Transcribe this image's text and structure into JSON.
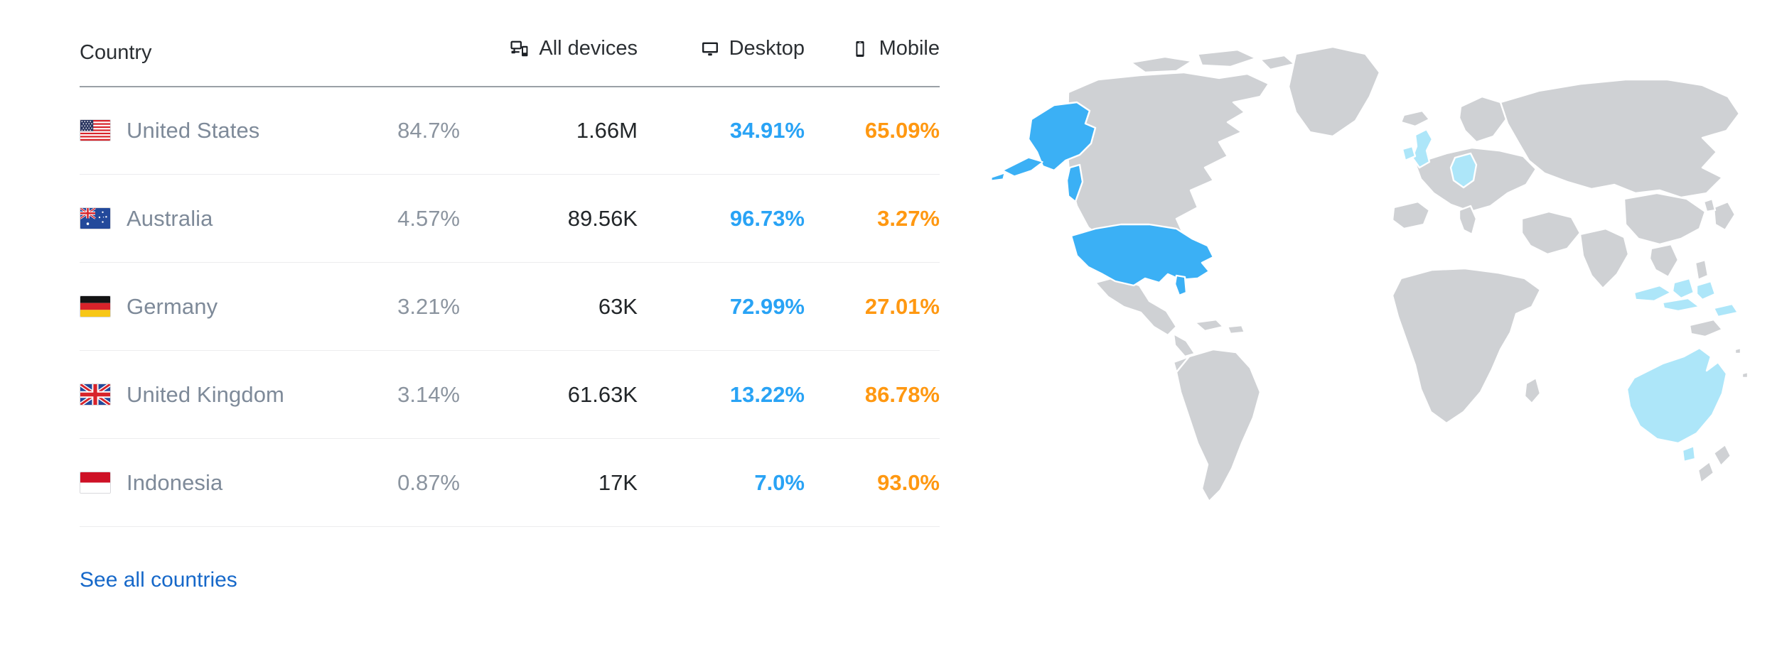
{
  "table": {
    "headers": {
      "country": "Country",
      "share": "",
      "all_devices": "All devices",
      "desktop": "Desktop",
      "mobile": "Mobile"
    },
    "header_icons": {
      "all_devices": "all-devices-icon",
      "desktop": "desktop-monitor-icon",
      "mobile": "mobile-phone-icon"
    },
    "rows": [
      {
        "flag": "flag-us",
        "country": "United States",
        "share": "84.7%",
        "all_devices": "1.66M",
        "desktop": "34.91%",
        "mobile": "65.09%"
      },
      {
        "flag": "flag-au",
        "country": "Australia",
        "share": "4.57%",
        "all_devices": "89.56K",
        "desktop": "96.73%",
        "mobile": "3.27%"
      },
      {
        "flag": "flag-de",
        "country": "Germany",
        "share": "3.21%",
        "all_devices": "63K",
        "desktop": "72.99%",
        "mobile": "27.01%"
      },
      {
        "flag": "flag-gb",
        "country": "United Kingdom",
        "share": "3.14%",
        "all_devices": "61.63K",
        "desktop": "13.22%",
        "mobile": "86.78%"
      },
      {
        "flag": "flag-id",
        "country": "Indonesia",
        "share": "0.87%",
        "all_devices": "17K",
        "desktop": "7.0%",
        "mobile": "93.0%"
      }
    ],
    "footer_link": "See all countries"
  },
  "map": {
    "name": "world-choropleth-map",
    "highlight_primary": [
      "United States"
    ],
    "highlight_secondary": [
      "Australia",
      "Germany",
      "United Kingdom",
      "Indonesia"
    ]
  },
  "colors": {
    "desktop_value": "#29A3F5",
    "mobile_value": "#FF9811",
    "country_name": "#7E8A99",
    "share_value": "#8B949F",
    "all_devices_value": "#222629",
    "link": "#1668C9",
    "map_base": "#CFD1D4",
    "map_highlight_primary": "#3BB0F5",
    "map_highlight_secondary": "#ADE6F9",
    "map_border": "#FFFFFF",
    "header_rule": "#9AA0A6",
    "row_rule": "#ECECEE"
  }
}
